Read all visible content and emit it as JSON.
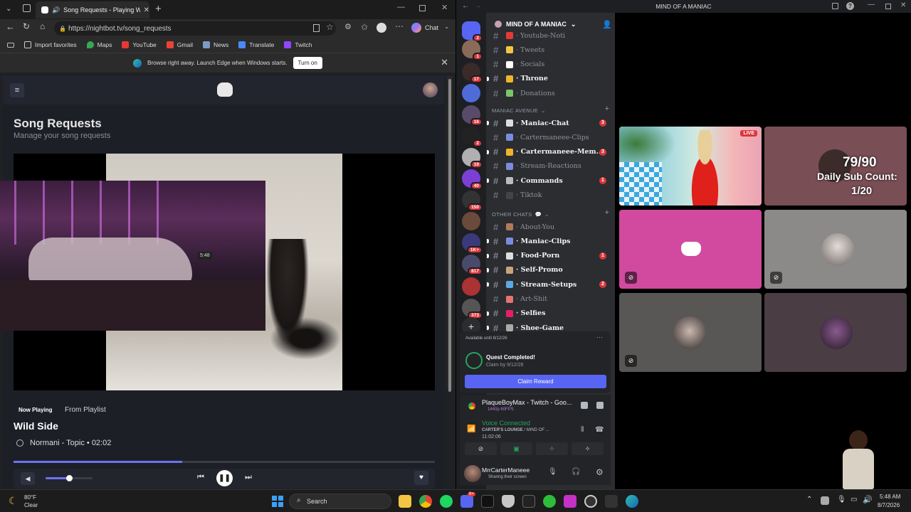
{
  "browser": {
    "tab_title": "Song Requests - Playing Wild",
    "url": "https://nightbot.tv/song_requests",
    "chat_label": "Chat",
    "favorites": [
      "Import favorites",
      "Maps",
      "YouTube",
      "Gmail",
      "News",
      "Translate",
      "Twitch"
    ],
    "infobar_text": "Browse right away. Launch Edge when Windows starts.",
    "infobar_button": "Turn on"
  },
  "nightbot": {
    "page_title": "Song Requests",
    "page_subtitle": "Manage your song requests",
    "webcam_clock": "5:48",
    "now_playing_label": "Now Playing",
    "from_playlist_label": "From Playlist",
    "song_title": "Wild Side",
    "song_artist": "Normani - Topic",
    "song_duration": "02:02",
    "progress_fraction": 0.4,
    "volume_fraction": 0.5
  },
  "discord": {
    "window_title": "MIND OF A MANIAC",
    "server_name": "MIND OF A MANIAC",
    "guild_badges": [
      "2",
      "1",
      "17",
      "",
      "16",
      "2",
      "19",
      "40",
      "150",
      "",
      "1K+",
      "817",
      "",
      "373"
    ],
    "channels_top": [
      {
        "name": "· Youtube-Noti",
        "bold": false,
        "emoji_color": "#e53935"
      },
      {
        "name": "· Tweets",
        "bold": false,
        "emoji_color": "#f4c542"
      },
      {
        "name": "· Socials",
        "bold": false,
        "emoji_color": "#ffffff"
      },
      {
        "name": "· Throne",
        "bold": true,
        "emoji_color": "#f0b429"
      },
      {
        "name": "· Donations",
        "bold": false,
        "emoji_color": "#7cc36a"
      }
    ],
    "category_avenue": "MANIAC AVENUE",
    "channels_avenue": [
      {
        "name": "· Maniac-Chat",
        "bold": true,
        "mentions": "3",
        "emoji_color": "#ddd"
      },
      {
        "name": "· Cartermaneee-Clips",
        "bold": false,
        "mentions": "",
        "emoji_color": "#7b8cde"
      },
      {
        "name": "· Cartermaneee-Mem...",
        "bold": true,
        "mentions": "3",
        "emoji_color": "#f0b429"
      },
      {
        "name": "· Stream-Reactions",
        "bold": false,
        "mentions": "",
        "emoji_color": "#7b8cde"
      },
      {
        "name": "· Commands",
        "bold": true,
        "mentions": "1",
        "emoji_color": "#b9bbbe"
      },
      {
        "name": "· Tiktok",
        "bold": false,
        "mentions": "",
        "emoji_color": "#444"
      }
    ],
    "category_other": "OTHER CHATS",
    "channels_other": [
      {
        "name": "· About-You",
        "bold": false,
        "mentions": "",
        "emoji_color": "#b07a5a"
      },
      {
        "name": "· Maniac-Clips",
        "bold": true,
        "mentions": "",
        "emoji_color": "#7b8cde"
      },
      {
        "name": "· Food-Porn",
        "bold": true,
        "mentions": "1",
        "emoji_color": "#ddd"
      },
      {
        "name": "· Self-Promo",
        "bold": true,
        "mentions": "",
        "emoji_color": "#c9a27e"
      },
      {
        "name": "· Stream-Setups",
        "bold": true,
        "mentions": "2",
        "emoji_color": "#5aa9e6"
      },
      {
        "name": "· Art-Shit",
        "bold": false,
        "mentions": "",
        "emoji_color": "#e57373"
      },
      {
        "name": "· Selfies",
        "bold": true,
        "mentions": "",
        "emoji_color": "#e91e63"
      },
      {
        "name": "· Shoe-Game",
        "bold": true,
        "mentions": "",
        "emoji_color": "#aaa"
      }
    ],
    "quest_available": "Available until 8/12/26",
    "quest_title": "Quest Completed!",
    "quest_claim_by": "Claim by 9/12/26",
    "claim_button": "Claim Reward",
    "activity_title": "PlaqueBoyMax - Twitch - Goo...",
    "activity_sub": "1440p 60FPS",
    "voice_status": "Voice Connected",
    "voice_channel": "CARTER'S LOUNGE",
    "voice_server": "/ MIND OF ...",
    "voice_time": "11:02:06",
    "username": "MrrCarterManeee",
    "user_status": "Sharing their screen",
    "live_badge": "LIVE",
    "overlay_count": "79/90",
    "overlay_label": "Daily Sub Count:",
    "overlay_value": "1/20"
  },
  "taskbar": {
    "weather_temp": "80°F",
    "weather_desc": "Clear",
    "search_placeholder": "Search",
    "time": "5:48 AM",
    "date": "8/7/2026",
    "badge": "9+"
  }
}
